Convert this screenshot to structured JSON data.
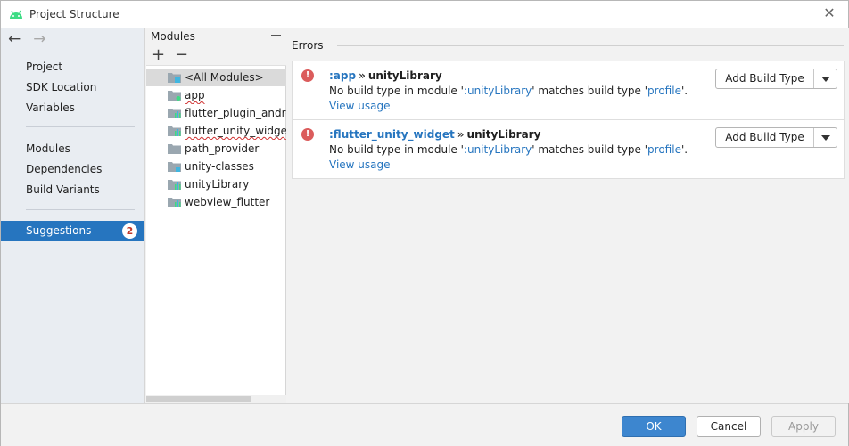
{
  "window": {
    "title": "Project Structure"
  },
  "nav": {
    "back_icon": "arrow-left-icon",
    "forward_icon": "arrow-right-icon",
    "items": [
      {
        "label": "Project"
      },
      {
        "label": "SDK Location"
      },
      {
        "label": "Variables"
      },
      {
        "label": "Modules"
      },
      {
        "label": "Dependencies"
      },
      {
        "label": "Build Variants"
      },
      {
        "label": "Suggestions",
        "badge": "2",
        "selected": true
      }
    ]
  },
  "modules_panel": {
    "title": "Modules",
    "add_icon": "plus-icon",
    "remove_icon": "minus-icon",
    "items": [
      {
        "label": "<All Modules>",
        "selected": true
      },
      {
        "label": "app"
      },
      {
        "label": "flutter_plugin_android_lifecycle"
      },
      {
        "label": "flutter_unity_widget"
      },
      {
        "label": "path_provider"
      },
      {
        "label": "unity-classes"
      },
      {
        "label": "unityLibrary"
      },
      {
        "label": "webview_flutter"
      }
    ]
  },
  "errors_panel": {
    "label": "Errors",
    "errors": [
      {
        "module": ":app",
        "separator": "»",
        "target": "unityLibrary",
        "msg_prefix": "No build type in module '",
        "msg_module": ":unityLibrary",
        "msg_middle": "' matches build type '",
        "msg_build_type": "profile",
        "msg_suffix": "'.",
        "view_usage": "View usage",
        "action": "Add Build Type"
      },
      {
        "module": ":flutter_unity_widget",
        "separator": "»",
        "target": "unityLibrary",
        "msg_prefix": "No build type in module '",
        "msg_module": ":unityLibrary",
        "msg_middle": "' matches build type '",
        "msg_build_type": "profile",
        "msg_suffix": "'.",
        "view_usage": "View usage",
        "action": "Add Build Type"
      }
    ]
  },
  "footer": {
    "ok": "OK",
    "cancel": "Cancel",
    "apply": "Apply"
  },
  "colors": {
    "accent": "#2675bf",
    "error": "#db5c5c",
    "ok_button": "#3d86cf"
  }
}
